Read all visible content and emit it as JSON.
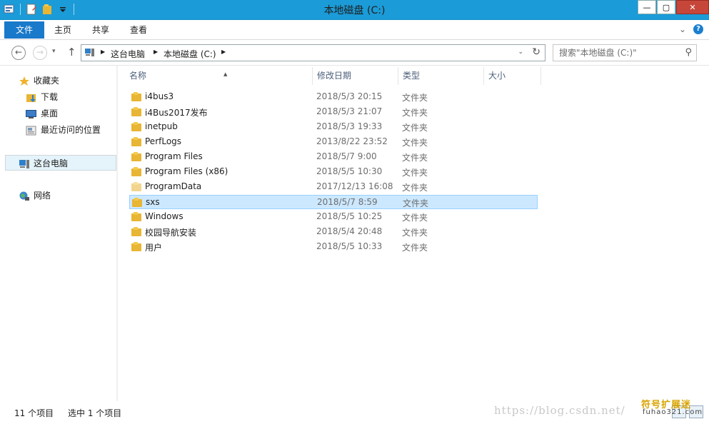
{
  "window": {
    "title": "本地磁盘 (C:)",
    "controls": {
      "minimize": "—",
      "maximize": "▢",
      "close": "✕"
    }
  },
  "quick_access_toolbar": {
    "icons": [
      "properties-icon",
      "new-document-icon",
      "new-folder-icon",
      "customize-dropdown-icon"
    ]
  },
  "ribbon": {
    "tabs": [
      "文件",
      "主页",
      "共享",
      "查看"
    ],
    "expand_icon": "chevron-down-icon",
    "help_label": "?"
  },
  "navigation": {
    "back": "←",
    "forward": "→",
    "recent": "▾",
    "up": "↑",
    "breadcrumbs": [
      "这台电脑",
      "本地磁盘 (C:)"
    ],
    "search_placeholder": "搜索\"本地磁盘 (C:)\""
  },
  "sidebar": {
    "groups": [
      {
        "label": "收藏夹",
        "icon": "star-icon",
        "items": [
          {
            "label": "下载",
            "icon": "downloads-folder-icon"
          },
          {
            "label": "桌面",
            "icon": "desktop-icon"
          },
          {
            "label": "最近访问的位置",
            "icon": "recent-places-icon"
          }
        ]
      },
      {
        "label": "这台电脑",
        "icon": "computer-icon",
        "selected": true,
        "items": []
      },
      {
        "label": "网络",
        "icon": "network-icon",
        "items": []
      }
    ]
  },
  "file_list": {
    "columns": [
      "名称",
      "修改日期",
      "类型",
      "大小"
    ],
    "sorted_by": "名称",
    "rows": [
      {
        "name": "i4bus3",
        "date": "2018/5/3 20:15",
        "type": "文件夹",
        "size": ""
      },
      {
        "name": "i4Bus2017发布",
        "date": "2018/5/3 21:07",
        "type": "文件夹",
        "size": ""
      },
      {
        "name": "inetpub",
        "date": "2018/5/3 19:33",
        "type": "文件夹",
        "size": ""
      },
      {
        "name": "PerfLogs",
        "date": "2013/8/22 23:52",
        "type": "文件夹",
        "size": ""
      },
      {
        "name": "Program Files",
        "date": "2018/5/7 9:00",
        "type": "文件夹",
        "size": ""
      },
      {
        "name": "Program Files (x86)",
        "date": "2018/5/5 10:30",
        "type": "文件夹",
        "size": ""
      },
      {
        "name": "ProgramData",
        "date": "2017/12/13 16:08",
        "type": "文件夹",
        "size": "",
        "hidden": true
      },
      {
        "name": "sxs",
        "date": "2018/5/7 8:59",
        "type": "文件夹",
        "size": "",
        "selected": true
      },
      {
        "name": "Windows",
        "date": "2018/5/5 10:25",
        "type": "文件夹",
        "size": ""
      },
      {
        "name": "校园导航安装",
        "date": "2018/5/4 20:48",
        "type": "文件夹",
        "size": ""
      },
      {
        "name": "用户",
        "date": "2018/5/5 10:33",
        "type": "文件夹",
        "size": ""
      }
    ]
  },
  "status_bar": {
    "item_count": "11 个项目",
    "selection": "选中 1 个项目"
  },
  "watermark": {
    "url": "https://blog.csdn.net/",
    "logo_cn": "符号扩展迷",
    "logo_en": "fuhao321.com"
  },
  "colors": {
    "titlebar": "#1b9bd7",
    "file_tab": "#1979ca",
    "selected_row": "#cce8ff",
    "folder": "#e8b534"
  }
}
